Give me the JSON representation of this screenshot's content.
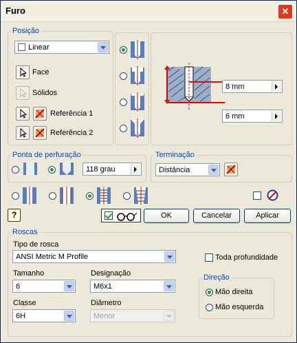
{
  "window": {
    "title": "Furo",
    "close_glyph": "✕"
  },
  "position": {
    "legend": "Posição",
    "placement_value": "Linear",
    "face_label": "Face",
    "solids_label": "Sólidos",
    "ref1_label": "Referência 1",
    "ref2_label": "Referência 2"
  },
  "preview": {
    "dim_top": "8 mm",
    "dim_bottom": "6 mm"
  },
  "drill_point": {
    "legend": "Ponta de perfuração",
    "angle": "118 grau"
  },
  "termination": {
    "legend": "Terminação",
    "value": "Distância"
  },
  "buttons": {
    "help": "?",
    "ok": "OK",
    "cancel": "Cancelar",
    "apply": "Aplicar"
  },
  "threads": {
    "legend": "Roscas",
    "type_label": "Tipo de rosca",
    "type_value": "ANSI Metric M Profile",
    "full_depth_label": "Toda profundidade",
    "size_label": "Tamanho",
    "size_value": "6",
    "designation_label": "Designação",
    "designation_value": "M6x1",
    "class_label": "Classe",
    "class_value": "6H",
    "diameter_label": "Diâmetro",
    "diameter_value": "Menor",
    "direction_legend": "Direção",
    "right_hand": "Mão direita",
    "left_hand": "Mão esquerda"
  },
  "colors": {
    "accent": "#0046d5",
    "dimension_red": "#e00000",
    "hatch_blue": "#5a7fb8"
  }
}
